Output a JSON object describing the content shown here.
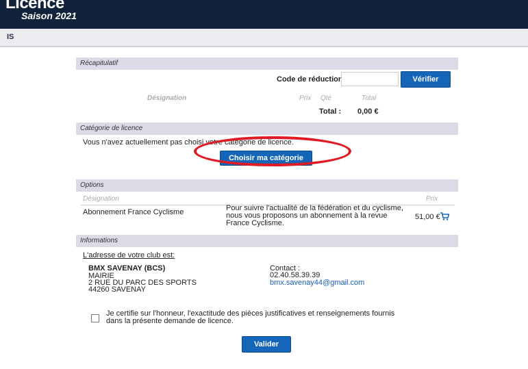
{
  "header": {
    "brand": "Licence",
    "season": "Saison 2021",
    "nav_text": "IS"
  },
  "recap": {
    "title": "Récapitulatif",
    "promo_label": "Code de réduction :",
    "promo_placeholder": "",
    "verify_label": "Vérifier",
    "columns": {
      "designation": "Désignation",
      "price": "Prix",
      "qty": "Qté",
      "total": "Total"
    },
    "total_label": "Total :",
    "total_value": "0,00 €"
  },
  "category": {
    "title": "Catégorie de licence",
    "message": "Vous n'avez actuellement pas choisi votre catégorie de licence.",
    "choose_label": "Choisir ma catégorie"
  },
  "options": {
    "title": "Options",
    "columns": {
      "designation": "Désignation",
      "price": "Prix"
    },
    "item": {
      "name": "Abonnement France Cyclisme",
      "description": "Pour suivre l'actualité de la fédération et du cyclisme, nous vous proposons un abonnement à la revue France Cyclisme.",
      "price": "51,00 €",
      "cart_icon": "cart-icon"
    }
  },
  "info": {
    "title": "Informations",
    "club_heading": "L'adresse de votre club est:",
    "club_name": "BMX SAVENAY (BCS)",
    "address_line1": "MAIRIE",
    "address_line2": "2 RUE DU PARC DES SPORTS",
    "address_line3": "44260 SAVENAY",
    "contact_label": "Contact :",
    "phone": "02.40.58.39.39",
    "email": "bmx.savenay44@gmail.com"
  },
  "certify": {
    "text": "Je certifie sur l'honneur, l'exactitude des pièces justificatives et renseignements fournis dans la présente demande de licence.",
    "checked": false
  },
  "submit_label": "Valider",
  "colors": {
    "accent": "#1565b8",
    "header_bg": "#10233a",
    "section_bg": "#dadbe7",
    "highlight": "#e01b24"
  }
}
